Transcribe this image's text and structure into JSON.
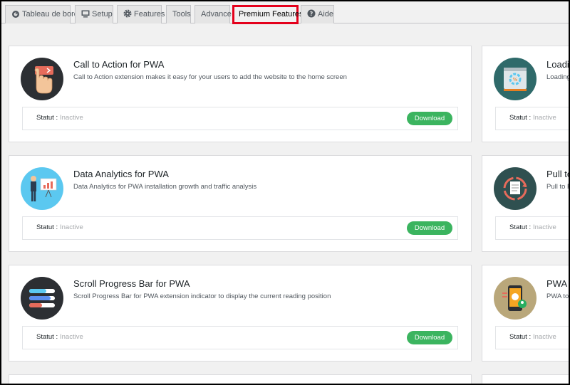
{
  "tabs": [
    {
      "label": "Tableau de bord",
      "icon": "dashboard-icon"
    },
    {
      "label": "Setup",
      "icon": "monitor-icon"
    },
    {
      "label": "Features",
      "icon": "gear-icon"
    },
    {
      "label": "Tools",
      "icon": ""
    },
    {
      "label": "Advance",
      "icon": ""
    },
    {
      "label": "Premium Features",
      "icon": "",
      "active": true
    },
    {
      "label": "Aide",
      "icon": "question-icon"
    }
  ],
  "status_label": "Statut :",
  "status_value": "Inactive",
  "download_label": "Download",
  "cards_left": [
    {
      "title": "Call to Action for PWA",
      "desc": "Call to Action extension makes it easy for your users to add the website to the home screen",
      "icon": "hand-pointer-icon"
    },
    {
      "title": "Data Analytics for PWA",
      "desc": "Data Analytics for PWA installation growth and traffic analysis",
      "icon": "presentation-analytics-icon"
    },
    {
      "title": "Scroll Progress Bar for PWA",
      "desc": "Scroll Progress Bar for PWA extension indicator to display the current reading position",
      "icon": "progress-bars-icon"
    }
  ],
  "cards_right": [
    {
      "title": "Loadin",
      "desc": "Loading",
      "icon": "loading-screen-icon"
    },
    {
      "title": "Pull to",
      "desc": "Pull to Re",
      "icon": "pull-to-refresh-icon"
    },
    {
      "title": "PWA t",
      "desc": "PWA to A",
      "icon": "phone-app-icon"
    }
  ],
  "colors": {
    "active_tab_border": "#e4001b",
    "download": "#3bb45f",
    "inactive_text": "#a7aaad"
  }
}
